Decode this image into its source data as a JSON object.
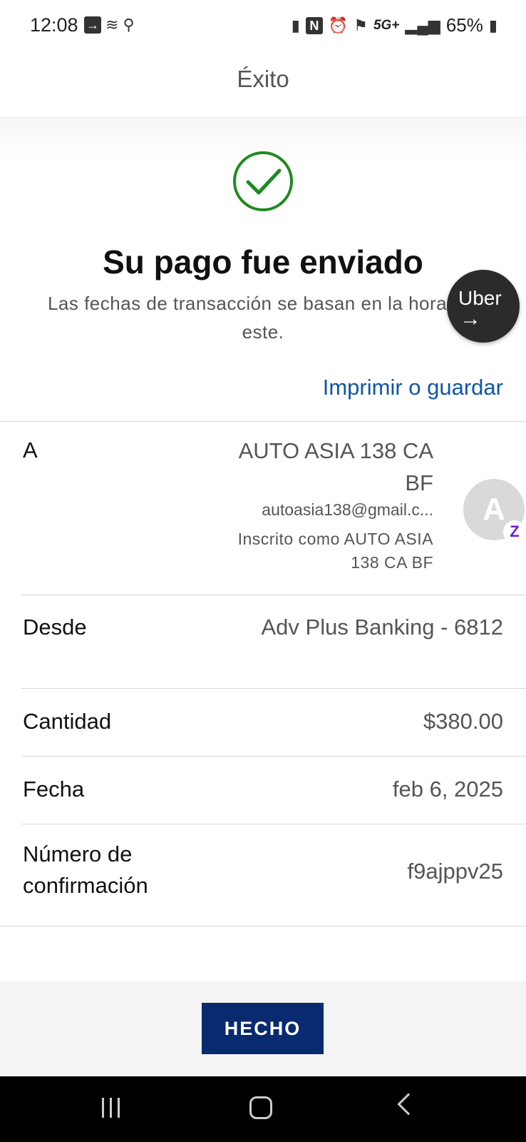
{
  "status_bar": {
    "time": "12:08",
    "network": "5G+",
    "battery": "65%"
  },
  "header": {
    "title": "Éxito"
  },
  "hero": {
    "headline": "Su pago fue enviado",
    "subtext": "Las fechas de transacción se basan en la hora del este.",
    "print_link": "Imprimir o guardar"
  },
  "uber_bubble": {
    "label": "Uber",
    "arrow": "→"
  },
  "details": {
    "to": {
      "label": "A",
      "name": "AUTO ASIA 138 CA BF",
      "email": "autoasia138@gmail.c...",
      "enrolled": "Inscrito como AUTO ASIA 138 CA BF",
      "avatar_letter": "A",
      "badge": "Z"
    },
    "from": {
      "label": "Desde",
      "value": "Adv Plus Banking - 6812"
    },
    "amount": {
      "label": "Cantidad",
      "value": "$380.00"
    },
    "date": {
      "label": "Fecha",
      "value": "feb 6, 2025"
    },
    "confirmation": {
      "label": "Número de confirmación",
      "value": "f9ajppv25"
    }
  },
  "footer": {
    "done_label": "HECHO"
  },
  "colors": {
    "success_green": "#1f8a1f",
    "link_blue": "#0f56a8",
    "button_navy": "#0a2a6f",
    "zelle_purple": "#6d1ed4"
  }
}
